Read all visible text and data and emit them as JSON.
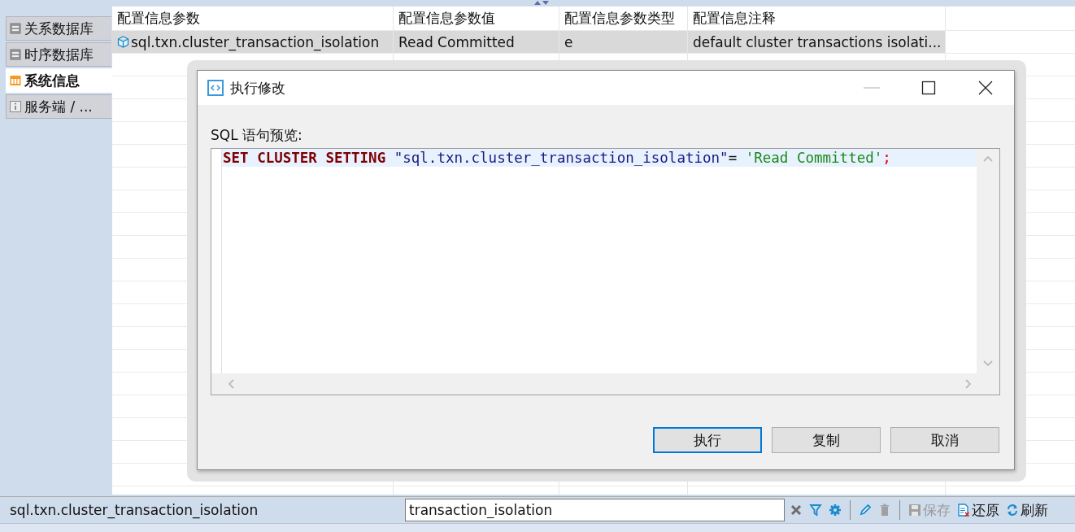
{
  "sidebar": {
    "tabs": [
      {
        "label": "关系数据库",
        "selected": false
      },
      {
        "label": "时序数据库",
        "selected": false
      },
      {
        "label": "系统信息",
        "selected": true
      },
      {
        "label": "服务端 / ...",
        "selected": false
      }
    ]
  },
  "table": {
    "columns": [
      "配置信息参数",
      "配置信息参数值",
      "配置信息参数类型",
      "配置信息注释"
    ],
    "rows": [
      {
        "cells": [
          "sql.txn.cluster_transaction_isolation",
          "Read Committed",
          "e",
          "default cluster transactions isolati..."
        ],
        "selected": true
      }
    ]
  },
  "dialog": {
    "title": "执行修改",
    "preview_label": "SQL 语句预览:",
    "sql": [
      {
        "kind": "keyword",
        "text": "SET CLUSTER SETTING"
      },
      {
        "kind": "identifier",
        "text": "\"sql.txn.cluster_transaction_isolation\""
      },
      {
        "kind": "plain",
        "text": "= "
      },
      {
        "kind": "literal",
        "text": "'Read Committed'"
      },
      {
        "kind": "punct",
        "text": ";"
      }
    ],
    "buttons": [
      {
        "label": "执行",
        "default": true
      },
      {
        "label": "复制",
        "default": false
      },
      {
        "label": "取消",
        "default": false
      }
    ]
  },
  "bottom_bar": {
    "current_key": "sql.txn.cluster_transaction_isolation",
    "search_value": "transaction_isolation",
    "tools": [
      {
        "kind": "tool",
        "disabled": false
      },
      {
        "kind": "tool",
        "disabled": false
      },
      {
        "kind": "tool",
        "disabled": false
      },
      {
        "kind": "separator"
      },
      {
        "kind": "tool",
        "disabled": false
      },
      {
        "kind": "tool",
        "disabled": true
      },
      {
        "kind": "separator"
      },
      {
        "kind": "tool",
        "label": "保存",
        "disabled": true
      },
      {
        "kind": "tool",
        "label": "还原",
        "disabled": false
      },
      {
        "kind": "tool",
        "label": "刷新",
        "disabled": false
      }
    ]
  }
}
